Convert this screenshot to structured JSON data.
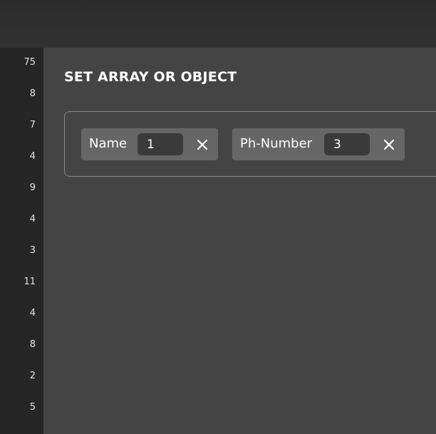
{
  "gutter": {
    "line_numbers": [
      "75",
      "8",
      "7",
      "4",
      "9",
      "4",
      "3",
      "11",
      "4",
      "8",
      "2",
      "5"
    ]
  },
  "panel": {
    "title": "SET ARRAY OR OBJECT",
    "fields": [
      {
        "label": "Name",
        "value": "1",
        "remove_icon": "close-icon"
      },
      {
        "label": "Ph-Number",
        "value": "3",
        "remove_icon": "close-icon"
      }
    ]
  },
  "colors": {
    "topbar": "#2e2e2e",
    "gutter": "#262626",
    "panel": "#444444",
    "chip": "#666666",
    "input": "#3a3a3a",
    "text": "#ffffff"
  }
}
